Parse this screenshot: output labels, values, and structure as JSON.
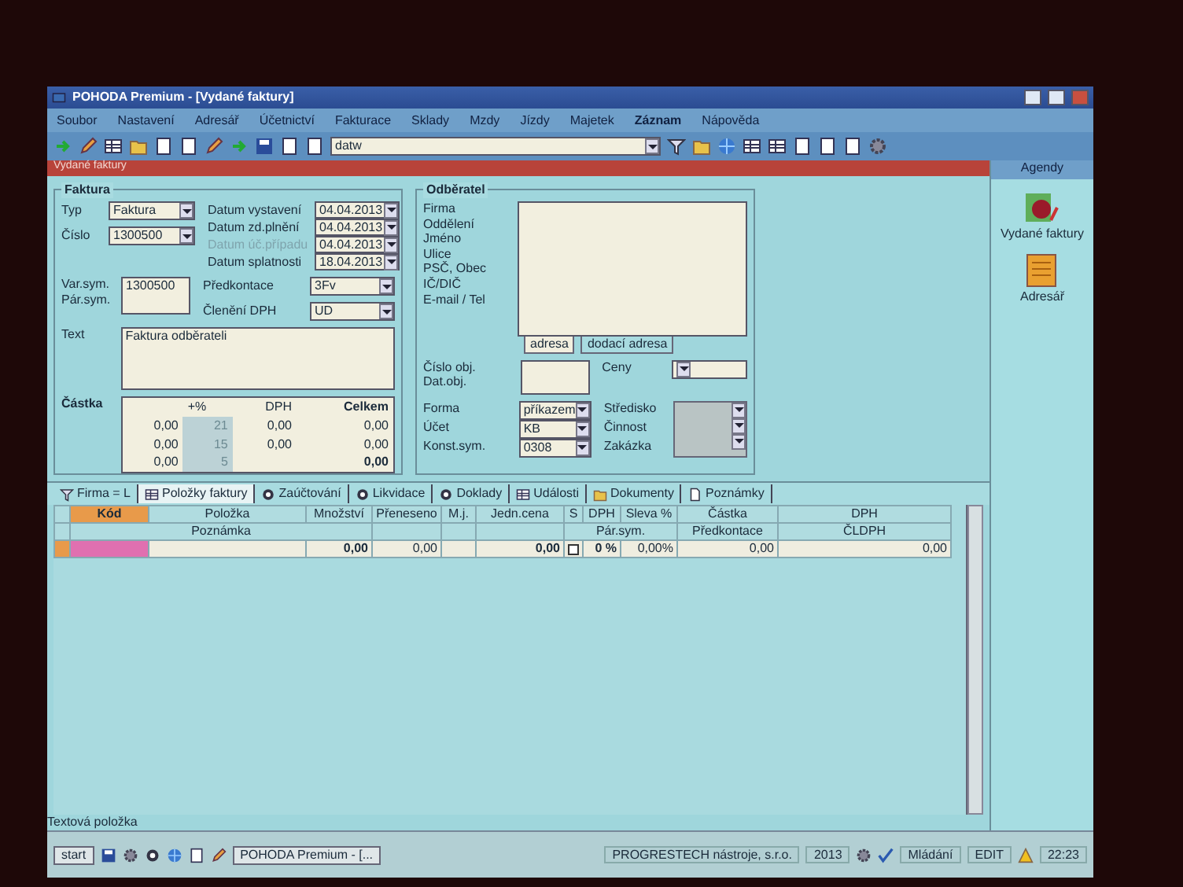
{
  "window": {
    "title": "POHODA Premium - [Vydané faktury]"
  },
  "menu": [
    {
      "label": "Soubor",
      "emphasized": false
    },
    {
      "label": "Nastavení",
      "emphasized": false
    },
    {
      "label": "Adresář",
      "emphasized": false
    },
    {
      "label": "Účetnictví",
      "emphasized": false
    },
    {
      "label": "Fakturace",
      "emphasized": false
    },
    {
      "label": "Sklady",
      "emphasized": false
    },
    {
      "label": "Mzdy",
      "emphasized": false
    },
    {
      "label": "Jízdy",
      "emphasized": false
    },
    {
      "label": "Majetek",
      "emphasized": false
    },
    {
      "label": "Záznam",
      "emphasized": true
    },
    {
      "label": "Nápověda",
      "emphasized": false
    }
  ],
  "toolbar": {
    "combo_value": "datw"
  },
  "agenda_title": "Vydané faktury",
  "invoice": {
    "title": "Faktura",
    "fields": [
      {
        "label": "Typ",
        "value": "Faktura"
      },
      {
        "label": "Číslo",
        "value": "1300500"
      }
    ],
    "dates": [
      {
        "label": "Datum vystavení",
        "value": "04.04.2013",
        "disabled": false
      },
      {
        "label": "Datum zd.plnění",
        "value": "04.04.2013",
        "disabled": false
      },
      {
        "label": "Datum úč.případu",
        "value": "04.04.2013",
        "disabled": true
      },
      {
        "label": "Datum splatnosti",
        "value": "18.04.2013",
        "disabled": false
      }
    ],
    "symbol_labels": [
      "Var.sym.",
      "Pár.sym."
    ],
    "symbol_value": "1300500",
    "accounting": [
      {
        "label": "Předkontace",
        "value": "3Fv"
      },
      {
        "label": "Členění DPH",
        "value": "UD"
      }
    ],
    "text_label": "Text",
    "text_value": "Faktura odběrateli"
  },
  "amounts": {
    "title": "Částka",
    "columns": [
      "+%",
      "DPH",
      "Celkem"
    ],
    "rows": [
      {
        "base": "0,00",
        "rate": "21",
        "vat": "0,00",
        "total": "0,00"
      },
      {
        "base": "0,00",
        "rate": "15",
        "vat": "0,00",
        "total": "0,00"
      },
      {
        "base": "0,00",
        "rate": "5"
      }
    ],
    "grand_total": "0,00"
  },
  "customer": {
    "title": "Odběratel",
    "labels": [
      "Firma",
      "Oddělení",
      "Jméno",
      "Ulice",
      "PSČ, Obec",
      "IČ/DIČ",
      "E-mail / Tel"
    ],
    "address_tabs": [
      {
        "label": "adresa",
        "selected": true
      },
      {
        "label": "dodací adresa",
        "selected": false
      }
    ],
    "order_labels": [
      "Číslo obj.",
      "Dat.obj."
    ],
    "prices_label": "Ceny",
    "payment": [
      {
        "label": "Forma",
        "value": "příkazem"
      },
      {
        "label": "Účet",
        "value": "KB"
      },
      {
        "label": "Konst.sym.",
        "value": "0308"
      }
    ],
    "cost_labels": [
      "Středisko",
      "Činnost",
      "Zakázka"
    ]
  },
  "sidebar": {
    "title": "Agendy",
    "items": [
      {
        "label": "Vydané faktury",
        "kind": "invoices"
      },
      {
        "label": "Adresář",
        "kind": "addressbook"
      }
    ]
  },
  "detail_tabs": [
    {
      "label": "Firma = L",
      "kind": "filter",
      "selected": false
    },
    {
      "label": "Položky faktury",
      "kind": "list",
      "selected": true
    },
    {
      "label": "Zaúčtování",
      "kind": "circle",
      "selected": false
    },
    {
      "label": "Likvidace",
      "kind": "circle",
      "selected": false
    },
    {
      "label": "Doklady",
      "kind": "circle",
      "selected": false
    },
    {
      "label": "Události",
      "kind": "list",
      "selected": false
    },
    {
      "label": "Dokumenty",
      "kind": "folder",
      "selected": false
    },
    {
      "label": "Poznámky",
      "kind": "page",
      "selected": false
    }
  ],
  "grid": {
    "columns": [
      "Kód",
      "Položka",
      "Množství",
      "Přeneseno",
      "M.j.",
      "Jedn.cena",
      "S",
      "DPH",
      "Sleva %",
      "Částka",
      "DPH"
    ],
    "subcolumns": {
      "note": "Poznámka",
      "pair": "Pár.sym.",
      "preaccount": "Předkontace",
      "vat_line": "ČLDPH"
    },
    "rows": [
      {
        "quantity": "0,00",
        "transferred": "0,00",
        "unit_price": "0,00",
        "checked": false,
        "vat": "0 %",
        "discount": "0,00%",
        "amount": "0,00",
        "vat_amount": "0,00"
      }
    ]
  },
  "status_bar": {
    "hint": "Textová položka",
    "company": "PROGRESTECH nástroje, s.r.o.",
    "year": "2013",
    "mode": "Mládání",
    "edit": "EDIT"
  },
  "taskbar": {
    "start": "start",
    "task": "POHODA Premium - [...",
    "clock": "22:23"
  }
}
